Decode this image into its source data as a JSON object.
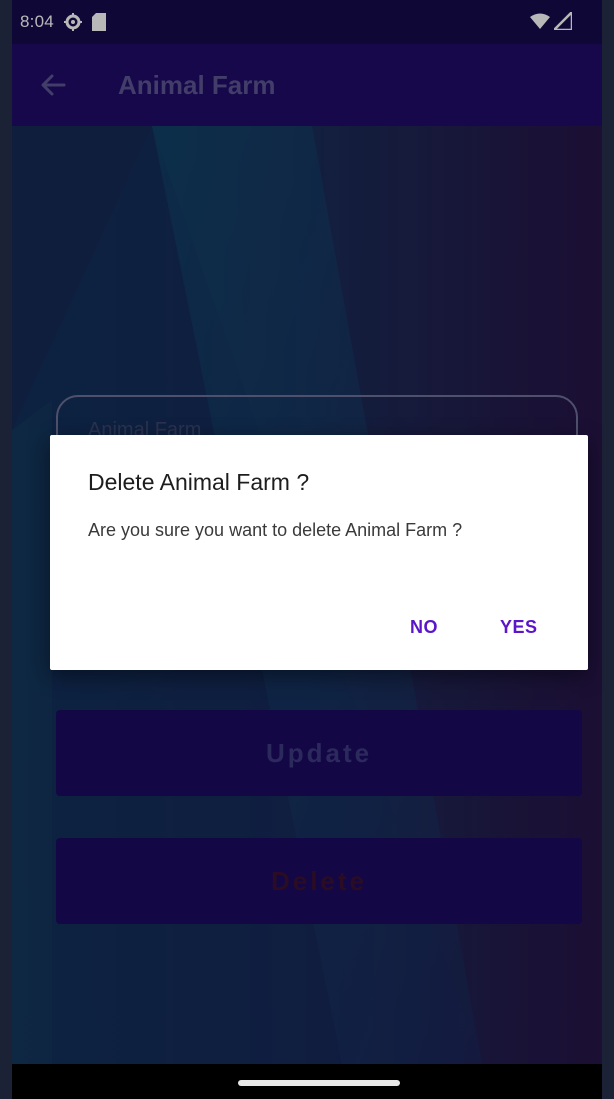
{
  "status_bar": {
    "time": "8:04",
    "icons": [
      "settings-gear-icon",
      "sd-card-icon",
      "wifi-icon",
      "signal-icon"
    ]
  },
  "app_bar": {
    "title": "Animal Farm",
    "back_icon": "arrow-left-icon"
  },
  "form": {
    "field_value": "Animal Farm",
    "update_label": "Update",
    "delete_label": "Delete"
  },
  "dialog": {
    "title": "Delete Animal Farm ?",
    "message": "Are you sure you want to delete Animal Farm ?",
    "no_label": "NO",
    "yes_label": "YES"
  },
  "colors": {
    "app_bar": "#1f0c68",
    "status_bar": "#160a4a",
    "dialog_accent": "#5a16c8",
    "button_bg": "#1b0a62"
  }
}
